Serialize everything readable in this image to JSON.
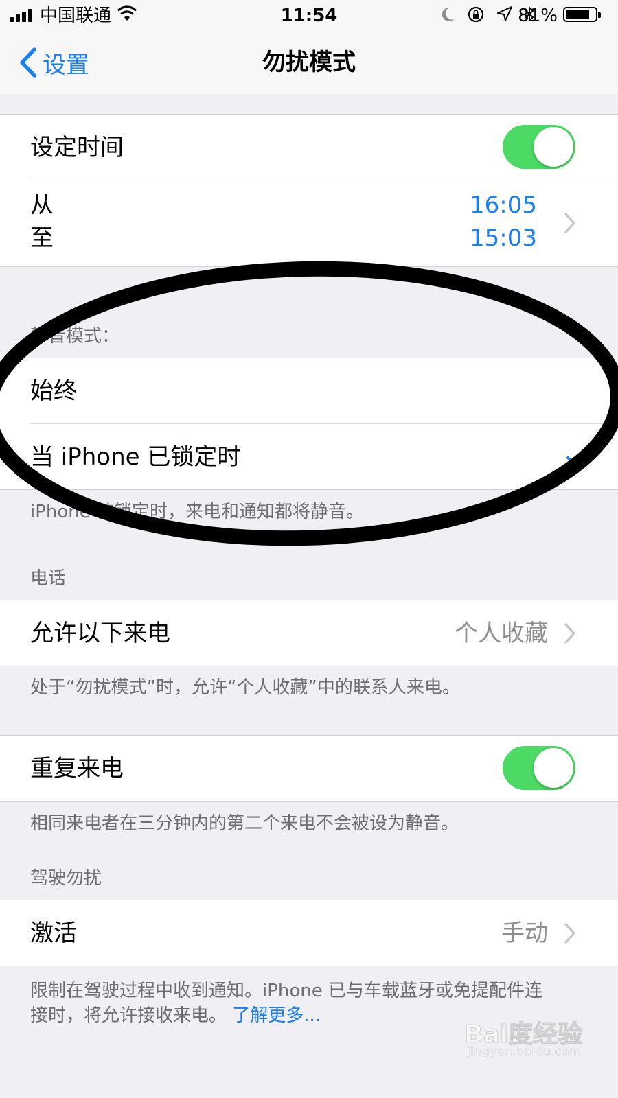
{
  "status_bar": {
    "carrier": "中国联通",
    "time": "11:54",
    "battery": "81%",
    "battery_level": 0.81
  },
  "nav": {
    "back_label": "设置",
    "title": "勿扰模式"
  },
  "schedule": {
    "label": "设定时间",
    "enabled": true,
    "from_label": "从",
    "to_label": "至",
    "from_time": "16:05",
    "to_time": "15:03"
  },
  "silence": {
    "header": "静音模式：",
    "options": [
      {
        "label": "始终",
        "selected": false
      },
      {
        "label": "当 iPhone 已锁定时",
        "selected": true
      }
    ],
    "footer": "iPhone 被锁定时，来电和通知都将静音。"
  },
  "phone": {
    "header": "电话",
    "allow_calls_label": "允许以下来电",
    "allow_calls_value": "个人收藏",
    "allow_calls_footer": "处于“勿扰模式”时，允许“个人收藏”中的联系人来电。",
    "repeated_calls_label": "重复来电",
    "repeated_calls_enabled": true,
    "repeated_calls_footer": "相同来电者在三分钟内的第二个来电不会被设为静音。"
  },
  "driving": {
    "header": "驾驶勿扰",
    "activate_label": "激活",
    "activate_value": "手动",
    "footer_line1": "限制在驾驶过程中收到通知。iPhone 已与车载蓝牙或免提配件连",
    "footer_line2": "接时，将允许接收来电。",
    "learn_more": "了解更多..."
  },
  "watermark": {
    "main": "Bai度经验",
    "sub": "jingyan.baidu.com"
  },
  "colors": {
    "accent": "#1a7ef5",
    "toggle_on": "#4cd964",
    "background": "#efeff4",
    "secondary_text": "#6d6d72"
  }
}
